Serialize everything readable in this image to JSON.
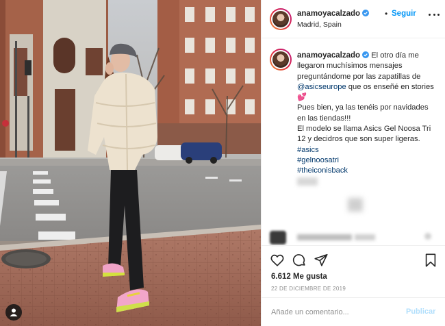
{
  "post": {
    "username": "anamoyacalzado",
    "follow_label": "Seguir",
    "separator": "•",
    "location": "Madrid, Spain"
  },
  "caption": {
    "username": "anamoyacalzado",
    "text_1": "El otro día me llegaron muchísimos mensajes preguntándome por las zapatillas de",
    "mention": "@asicseurope",
    "text_2": "que os enseñé en stories 💕",
    "line_3": "Pues bien, ya las tenéis por navidades en las tiendas!!!",
    "line_4": "El modelo se llama Asics Gel Noosa Tri 12 y decidros que son super ligeras.",
    "hashtags": [
      "#asics",
      "#gelnoosatri",
      "#theiconisback"
    ]
  },
  "actions": {
    "icons": [
      "heart-icon",
      "comment-icon",
      "share-icon",
      "bookmark-icon"
    ],
    "likes": "6.612 Me gusta",
    "date": "22 DE DICIEMBRE DE 2019"
  },
  "comment_box": {
    "placeholder": "Añade un comentario...",
    "post_label": "Publicar"
  },
  "colors": {
    "link": "#00376b",
    "follow": "#0095f6",
    "post_disabled": "#b2dffc",
    "verified": "#3897f0"
  }
}
